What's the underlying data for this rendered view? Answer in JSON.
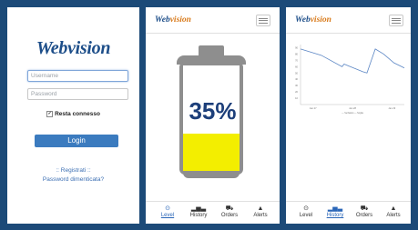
{
  "login": {
    "logo": "Webvision",
    "username_placeholder": "Username",
    "password_placeholder": "Password",
    "remember_label": "Resta connesso",
    "login_button": "Login",
    "register_link": ":: Registrati ::",
    "forgot_link": "Password dimenticata?"
  },
  "app": {
    "logo_prefix": "Web",
    "logo_suffix": "vision",
    "nav": [
      {
        "label": "Level",
        "icon": "clock-icon",
        "glyph": "⊙"
      },
      {
        "label": "History",
        "icon": "bar-chart-icon",
        "glyph": "▂▅▃"
      },
      {
        "label": "Orders",
        "icon": "truck-icon",
        "glyph": "⛟"
      },
      {
        "label": "Alerts",
        "icon": "bell-icon",
        "glyph": "▲"
      }
    ]
  },
  "level": {
    "percent_text": "35%",
    "fill_fraction": 0.35,
    "fill_color": "#f3ee00",
    "active_tab": "Level"
  },
  "history": {
    "active_tab": "History"
  },
  "colors": {
    "frame": "#1c4a78",
    "accent": "#3b7bbf",
    "logo": "#1d4e89",
    "logo_accent": "#d97a1a"
  },
  "chart_data": {
    "type": "line",
    "x_ticks": [
      "Jan 27",
      "Jan 28",
      "Jan 29"
    ],
    "y_ticks": [
      "10",
      "20",
      "30",
      "40",
      "50",
      "60",
      "70",
      "80",
      "90"
    ],
    "legend": [
      "Serbatoio",
      "Soglia"
    ],
    "series": [
      {
        "x": [
          0,
          0.2,
          0.4,
          0.42,
          0.6,
          0.64,
          0.72,
          0.8,
          0.9,
          1
        ],
        "y": [
          88,
          78,
          60,
          64,
          52,
          50,
          88,
          80,
          66,
          58
        ]
      }
    ],
    "ylim": [
      0,
      95
    ],
    "grid": false
  }
}
